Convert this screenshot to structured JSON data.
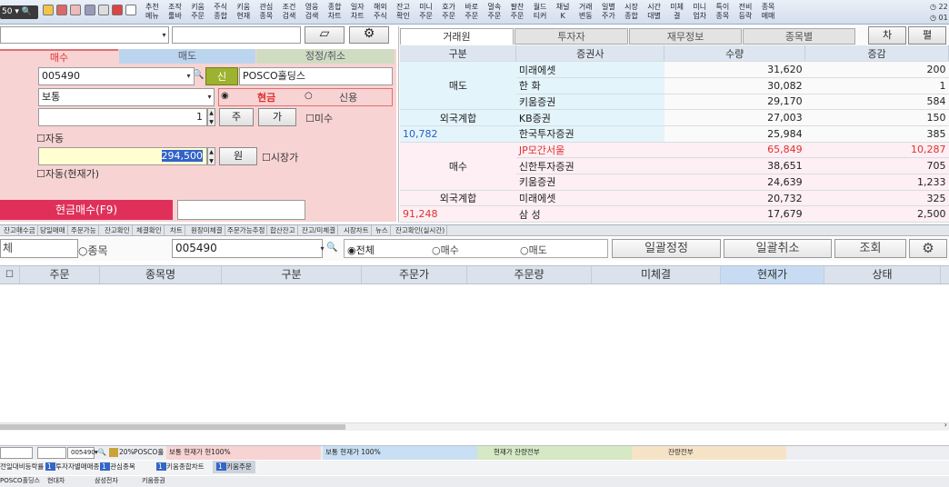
{
  "toolbar": {
    "combo_value": "50",
    "buttons": [
      {
        "l1": "추천",
        "l2": "메뉴"
      },
      {
        "l1": "조작",
        "l2": "툴바"
      },
      {
        "l1": "키움",
        "l2": "주문"
      },
      {
        "l1": "주식",
        "l2": "종합"
      },
      {
        "l1": "키움",
        "l2": "현재"
      },
      {
        "l1": "관심",
        "l2": "종목"
      },
      {
        "l1": "조건",
        "l2": "검색"
      },
      {
        "l1": "영웅",
        "l2": "검색"
      },
      {
        "l1": "종합",
        "l2": "차트"
      },
      {
        "l1": "일자",
        "l2": "차트"
      },
      {
        "l1": "해외",
        "l2": "주식"
      },
      {
        "l1": "잔고",
        "l2": "확인"
      },
      {
        "l1": "미니",
        "l2": "주문"
      },
      {
        "l1": "호가",
        "l2": "주문"
      },
      {
        "l1": "바로",
        "l2": "주문"
      },
      {
        "l1": "멀속",
        "l2": "주문"
      },
      {
        "l1": "팔찬",
        "l2": "주문"
      },
      {
        "l1": "월드",
        "l2": "티커"
      },
      {
        "l1": "채널",
        "l2": "K"
      },
      {
        "l1": "거래",
        "l2": "변동"
      },
      {
        "l1": "일별",
        "l2": "주가"
      },
      {
        "l1": "시장",
        "l2": "종합"
      },
      {
        "l1": "시간",
        "l2": "대별"
      },
      {
        "l1": "미체",
        "l2": "결"
      },
      {
        "l1": "미니",
        "l2": "업차"
      },
      {
        "l1": "특이",
        "l2": "종목"
      },
      {
        "l1": "전비",
        "l2": "등락"
      },
      {
        "l1": "종목",
        "l2": "메매"
      }
    ],
    "right_top": "22",
    "right_bottom": "01"
  },
  "left_form": {
    "tab_buy": "매수",
    "tab_sell": "매도",
    "tab_modify": "정정/취소",
    "stock_code": "005490",
    "new_badge": "신",
    "stock_name": "POSCO홀딩스",
    "order_type": "보통",
    "cash_label": "현금",
    "credit_label": "신용",
    "quantity": "1",
    "qty_unit_btn": "주",
    "qty_price_btn": "가",
    "unfilled_check": "미수",
    "auto_check": "자동",
    "price": "294,500",
    "won_btn": "원",
    "market_price_check": "시장가",
    "auto_current_check": "자동(현재가)",
    "submit_button": "현금매수(F9)"
  },
  "broker_tabs": [
    "거래원",
    "투자자",
    "재무정보",
    "종목별"
  ],
  "right_buttons": {
    "chart": "차",
    "flat": "펼"
  },
  "broker_table": {
    "headers": [
      "구분",
      "증권사",
      "수량",
      "증감"
    ],
    "sell_label": "매도",
    "buy_label": "매수",
    "foreign_label": "외국계합",
    "sell_foreign_value": "10,782",
    "buy_foreign_value": "91,248",
    "sell_rows": [
      {
        "broker": "미래에셋",
        "qty": "31,620",
        "chg": "200"
      },
      {
        "broker": "한  화",
        "qty": "30,082",
        "chg": "1"
      },
      {
        "broker": "키움증권",
        "qty": "29,170",
        "chg": "584"
      },
      {
        "broker": "KB증권",
        "qty": "27,003",
        "chg": "150"
      },
      {
        "broker": "한국투자증권",
        "qty": "25,984",
        "chg": "385"
      }
    ],
    "buy_rows": [
      {
        "broker": "JP모간서울",
        "qty": "65,849",
        "chg": "10,287"
      },
      {
        "broker": "신한투자증권",
        "qty": "38,651",
        "chg": "705"
      },
      {
        "broker": "키움증권",
        "qty": "24,639",
        "chg": "1,233"
      },
      {
        "broker": "미래에셋",
        "qty": "20,732",
        "chg": "325"
      },
      {
        "broker": "삼  성",
        "qty": "17,679",
        "chg": "2,500"
      }
    ]
  },
  "tabs2": [
    "잔고",
    "매수금",
    "당일매매",
    "주문가능",
    "잔고확인",
    "체결확인",
    "차트",
    "원장미체결",
    "주문가능추정",
    "합산잔고",
    "잔고/미체결",
    "시장차트",
    "뉴스",
    "잔고확인(실시간)"
  ],
  "filter": {
    "all_label": "체",
    "item_label": "○종목",
    "code_value": "005490",
    "radio_all": "◉전체",
    "radio_buy": "○매수",
    "radio_sell": "○매도",
    "batch_modify": "일괄정정",
    "batch_cancel": "일괄취소",
    "search": "조회"
  },
  "order_headers": [
    "주문",
    "종목명",
    "구분",
    "주문가",
    "주문량",
    "미체결",
    "현재가",
    "상태"
  ],
  "status1": {
    "code": "005490",
    "pct": "20%",
    "name": "POSCO홀",
    "s1": "보통  현재가  현100%",
    "s2": "보통  현재가  100%",
    "s3": "현재가  잔량전부",
    "s4": "잔량전부"
  },
  "status2": [
    "전일대비등락률",
    "투자자별매매종",
    "관심종목",
    "키움종합차트",
    "키움주문"
  ],
  "status3": [
    "POSCO홀딩스",
    "현대차",
    "삼성전자",
    "키움증권"
  ]
}
